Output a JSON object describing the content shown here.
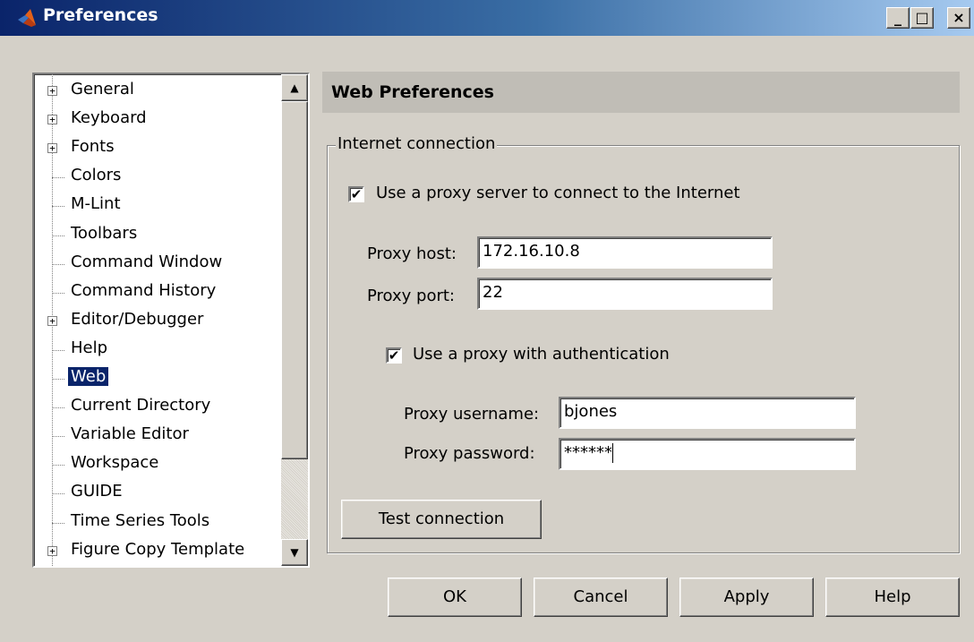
{
  "window": {
    "title": "Preferences",
    "minimize": "_",
    "maximize": "□",
    "close": "×"
  },
  "tree": {
    "items": [
      {
        "label": "General",
        "expandable": true
      },
      {
        "label": "Keyboard",
        "expandable": true
      },
      {
        "label": "Fonts",
        "expandable": true
      },
      {
        "label": "Colors",
        "expandable": false
      },
      {
        "label": "M-Lint",
        "expandable": false
      },
      {
        "label": "Toolbars",
        "expandable": false
      },
      {
        "label": "Command Window",
        "expandable": false
      },
      {
        "label": "Command History",
        "expandable": false
      },
      {
        "label": "Editor/Debugger",
        "expandable": true
      },
      {
        "label": "Help",
        "expandable": false
      },
      {
        "label": "Web",
        "expandable": false,
        "selected": true
      },
      {
        "label": "Current Directory",
        "expandable": false
      },
      {
        "label": "Variable Editor",
        "expandable": false
      },
      {
        "label": "Workspace",
        "expandable": false
      },
      {
        "label": "GUIDE",
        "expandable": false
      },
      {
        "label": "Time Series Tools",
        "expandable": false
      },
      {
        "label": "Figure Copy Template",
        "expandable": true
      }
    ],
    "scroll_up": "▲",
    "scroll_down": "▼"
  },
  "panel": {
    "header": "Web Preferences",
    "group_title": "Internet connection",
    "use_proxy_label": "Use a proxy server to connect to the Internet",
    "use_proxy_checked": "✔",
    "proxy_host_label": "Proxy host:",
    "proxy_host_value": "172.16.10.8",
    "proxy_port_label": "Proxy port:",
    "proxy_port_value": "22",
    "auth_label": "Use a proxy with authentication",
    "auth_checked": "✔",
    "username_label": "Proxy username:",
    "username_value": "bjones",
    "password_label": "Proxy password:",
    "password_value": "******",
    "test_button": "Test connection"
  },
  "buttons": {
    "ok": "OK",
    "cancel": "Cancel",
    "apply": "Apply",
    "help": "Help"
  }
}
